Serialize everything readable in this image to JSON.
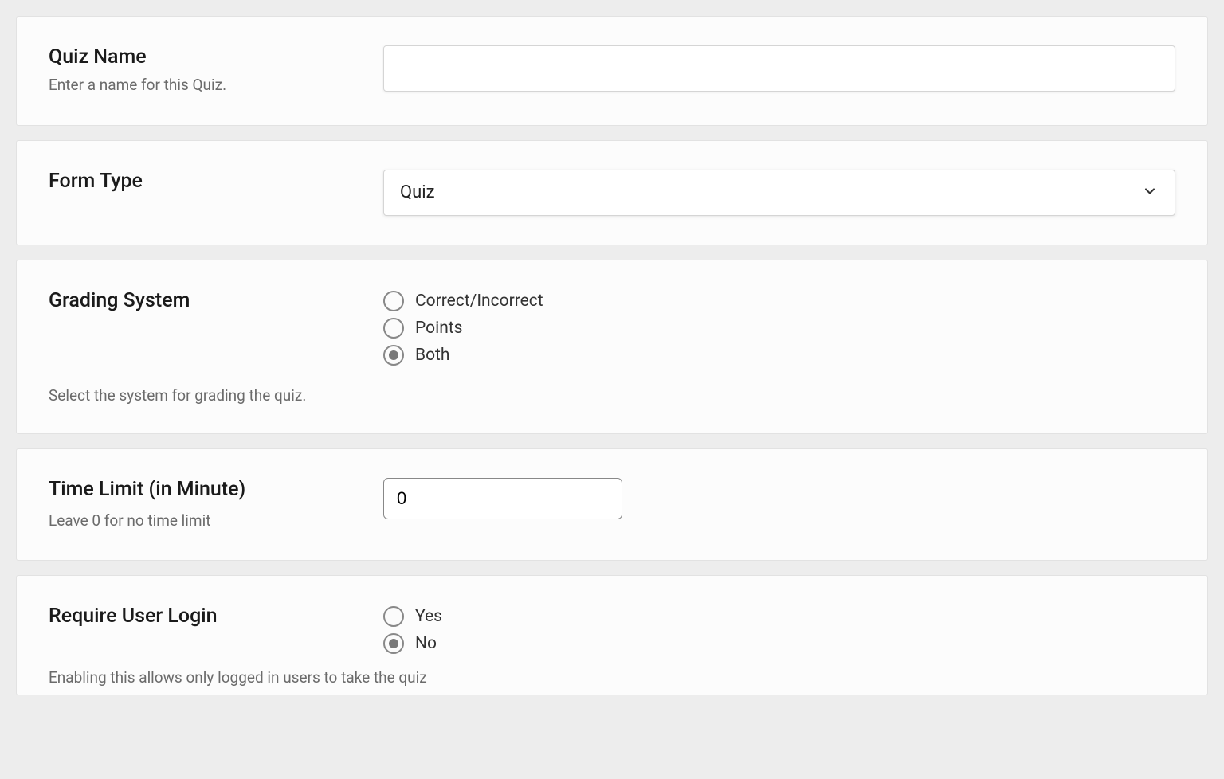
{
  "quizName": {
    "label": "Quiz Name",
    "desc": "Enter a name for this Quiz.",
    "value": ""
  },
  "formType": {
    "label": "Form Type",
    "selected": "Quiz"
  },
  "gradingSystem": {
    "label": "Grading System",
    "desc": "Select the system for grading the quiz.",
    "options": {
      "correct": "Correct/Incorrect",
      "points": "Points",
      "both": "Both"
    },
    "selected": "both"
  },
  "timeLimit": {
    "label": "Time Limit (in Minute)",
    "desc": "Leave 0 for no time limit",
    "value": "0"
  },
  "requireLogin": {
    "label": "Require User Login",
    "desc": "Enabling this allows only logged in users to take the quiz",
    "options": {
      "yes": "Yes",
      "no": "No"
    },
    "selected": "no"
  }
}
